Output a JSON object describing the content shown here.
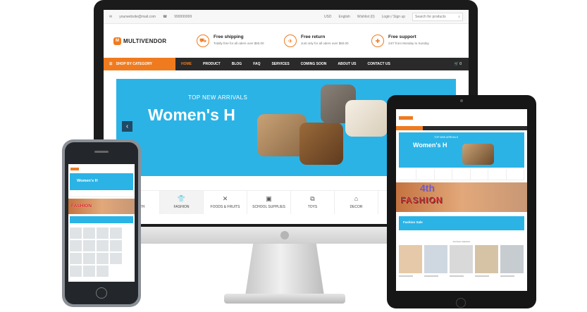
{
  "desktop": {
    "topbar": {
      "email": "yourwebsite@mail.com",
      "phone": "999999999",
      "currency": "USD",
      "language": "English",
      "wishlist": "Wishlist (0)",
      "login": "Login / Sign up",
      "search_placeholder": "Search for products"
    },
    "logo": "MULTIVENDOR",
    "features": [
      {
        "title": "Free shipping",
        "subtitle": "Totally free for all oders over $50.00"
      },
      {
        "title": "Free return",
        "subtitle": "Just only for all oders over $50.00"
      },
      {
        "title": "Free support",
        "subtitle": "24/7 from Monday to Sunday"
      }
    ],
    "nav": {
      "category_button": "SHOP BY CATEGORY",
      "items": [
        "HOME",
        "PRODUCT",
        "BLOG",
        "FAQ",
        "SERVICES",
        "COMING SOON",
        "ABOUT US",
        "CONTACT US"
      ],
      "active": "HOME",
      "cart_count": "0"
    },
    "banner": {
      "kicker": "TOP NEW ARRIVALS",
      "headline": "Women's H",
      "prev_icon": "chevron-left-icon",
      "background": "#2bb3e6"
    },
    "categories": [
      "HEALTH",
      "FASHION",
      "FOODS & FRUITS",
      "SCHOOL SUPPLIES",
      "TOYS",
      "DECOR"
    ]
  },
  "tablet": {
    "banner_kicker": "TOP NEW ARRIVALS",
    "banner_headline": "Women's H",
    "fashion_text": "FASHION",
    "fashion_number": "4th",
    "sale_text": "Fashion Sale",
    "best_label": "Full best collection"
  },
  "phone": {
    "banner_headline": "Women's H",
    "fashion_text": "FASHION"
  },
  "colors": {
    "accent": "#f07b1f",
    "nav_bg": "#2a2a2a",
    "banner": "#2bb3e6"
  }
}
